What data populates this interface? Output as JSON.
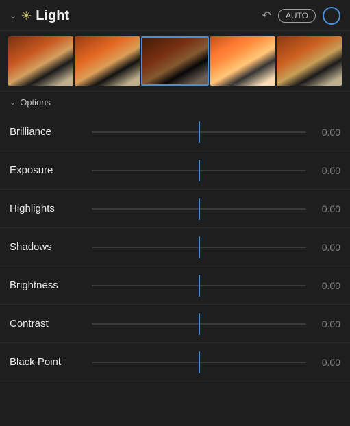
{
  "header": {
    "title": "Light",
    "auto_label": "AUTO",
    "chevron": "chevron-down",
    "sun": "☀",
    "undo": "↩"
  },
  "options": {
    "label": "Options"
  },
  "sliders": [
    {
      "label": "Brilliance",
      "value": "0.00"
    },
    {
      "label": "Exposure",
      "value": "0.00"
    },
    {
      "label": "Highlights",
      "value": "0.00"
    },
    {
      "label": "Shadows",
      "value": "0.00"
    },
    {
      "label": "Brightness",
      "value": "0.00"
    },
    {
      "label": "Contrast",
      "value": "0.00"
    },
    {
      "label": "Black Point",
      "value": "0.00"
    }
  ],
  "thumbnails": [
    {
      "id": 1,
      "selected": false
    },
    {
      "id": 2,
      "selected": false
    },
    {
      "id": 3,
      "selected": true
    },
    {
      "id": 4,
      "selected": false
    },
    {
      "id": 5,
      "selected": false
    }
  ],
  "colors": {
    "accent_blue": "#4a8fd4",
    "background": "#1e1e1e",
    "text_primary": "#e8e8e8",
    "text_secondary": "#808080"
  }
}
